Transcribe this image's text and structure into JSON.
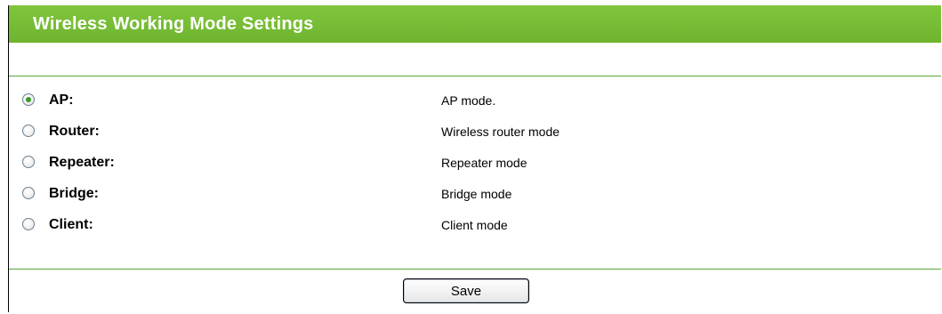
{
  "header": {
    "title": "Wireless Working Mode Settings"
  },
  "modes": [
    {
      "label": "AP:",
      "description": "AP mode.",
      "selected": true
    },
    {
      "label": "Router:",
      "description": "Wireless router mode",
      "selected": false
    },
    {
      "label": "Repeater:",
      "description": "Repeater mode",
      "selected": false
    },
    {
      "label": "Bridge:",
      "description": "Bridge mode",
      "selected": false
    },
    {
      "label": "Client:",
      "description": "Client mode",
      "selected": false
    }
  ],
  "actions": {
    "save_label": "Save"
  },
  "colors": {
    "header_green": "#7cc13a",
    "rule_green": "#5aa83a"
  }
}
